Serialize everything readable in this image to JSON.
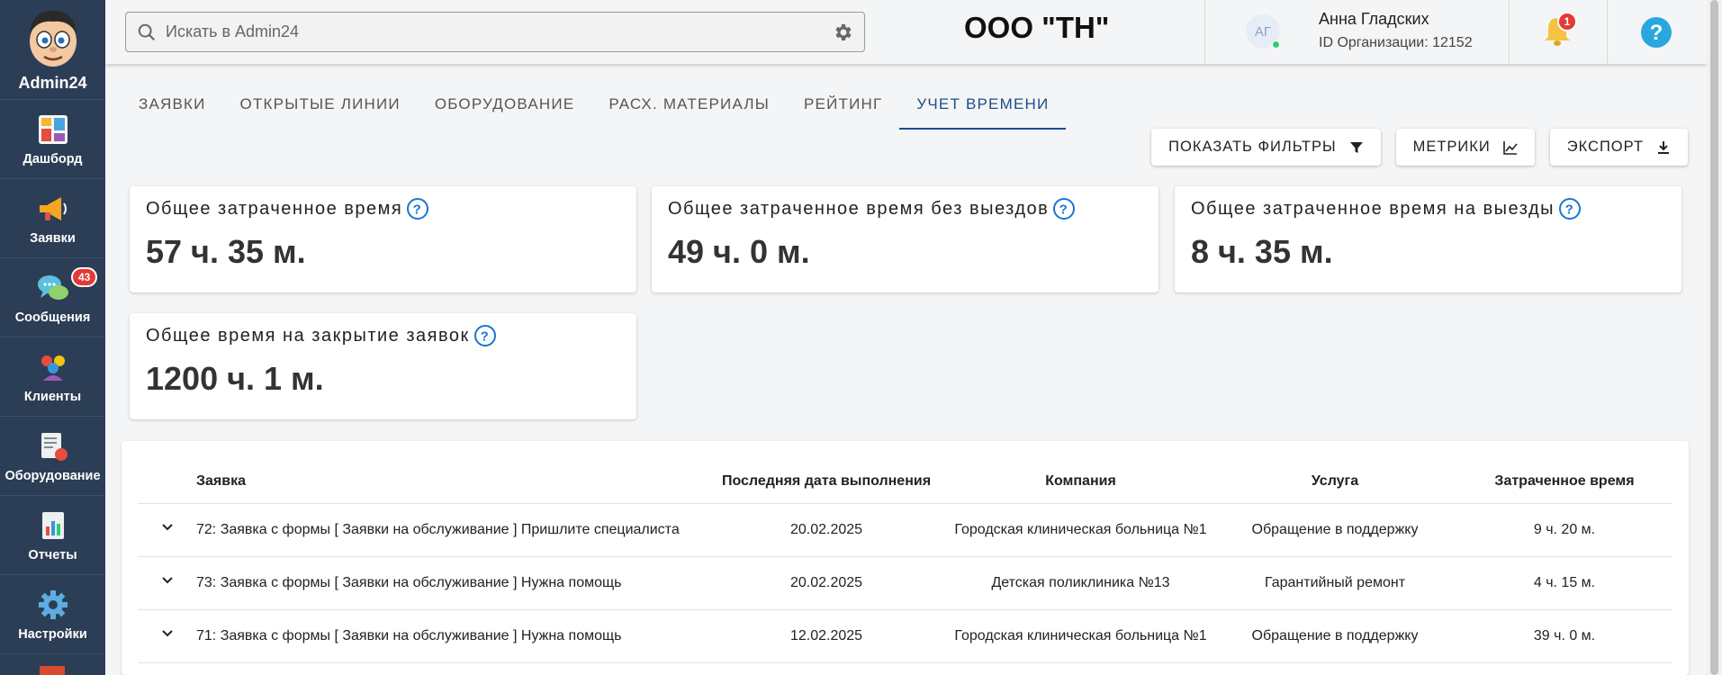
{
  "app": {
    "name": "Admin24"
  },
  "sidebar": {
    "items": [
      {
        "label": "Дашборд",
        "icon": "dashboard-icon"
      },
      {
        "label": "Заявки",
        "icon": "megaphone-icon"
      },
      {
        "label": "Сообщения",
        "icon": "chat-bubbles-icon",
        "badge": "43"
      },
      {
        "label": "Клиенты",
        "icon": "clients-icon"
      },
      {
        "label": "Оборудование",
        "icon": "equipment-icon"
      },
      {
        "label": "Отчеты",
        "icon": "reports-icon"
      },
      {
        "label": "Настройки",
        "icon": "gear-icon"
      }
    ]
  },
  "header": {
    "search_placeholder": "Искать в Admin24",
    "organization": "ООО \"ТН\"",
    "user": {
      "initials": "АГ",
      "name": "Анна Гладских",
      "org_id": "ID Организации: 12152"
    },
    "notifications_count": "1"
  },
  "tabs": [
    {
      "label": "Заявки",
      "active": false
    },
    {
      "label": "Открытые линии",
      "active": false
    },
    {
      "label": "Оборудование",
      "active": false
    },
    {
      "label": "Расх. материалы",
      "active": false
    },
    {
      "label": "Рейтинг",
      "active": false
    },
    {
      "label": "Учет времени",
      "active": true
    }
  ],
  "actions": {
    "filters": "Показать фильтры",
    "metrics": "Метрики",
    "export": "Экспорт"
  },
  "metrics": [
    {
      "title": "Общее затраченное время",
      "value": "57 ч. 35 м."
    },
    {
      "title": "Общее затраченное время без выездов",
      "value": "49 ч. 0 м."
    },
    {
      "title": "Общее затраченное время на выезды",
      "value": "8 ч. 35 м."
    },
    {
      "title": "Общее время на закрытие заявок",
      "value": "1200 ч. 1 м."
    }
  ],
  "table": {
    "columns": [
      "Заявка",
      "Последняя дата выполнения",
      "Компания",
      "Услуга",
      "Затраченное время"
    ],
    "rows": [
      [
        "72: Заявка с формы [ Заявки на обслуживание ] Пришлите специалиста",
        "20.02.2025",
        "Городская клиническая больница №1",
        "Обращение в поддержку",
        "9 ч. 20 м."
      ],
      [
        "73: Заявка с формы [ Заявки на обслуживание ] Нужна помощь",
        "20.02.2025",
        "Детская поликлиника №13",
        "Гарантийный ремонт",
        "4 ч. 15 м."
      ],
      [
        "71: Заявка с формы [ Заявки на обслуживание ] Нужна помощь",
        "12.02.2025",
        "Городская клиническая больница №1",
        "Обращение в поддержку",
        "39 ч. 0 м."
      ]
    ]
  },
  "colors": {
    "sidebar": "#2c3e55",
    "accent": "#1a4d8c",
    "badge": "#e53935"
  }
}
